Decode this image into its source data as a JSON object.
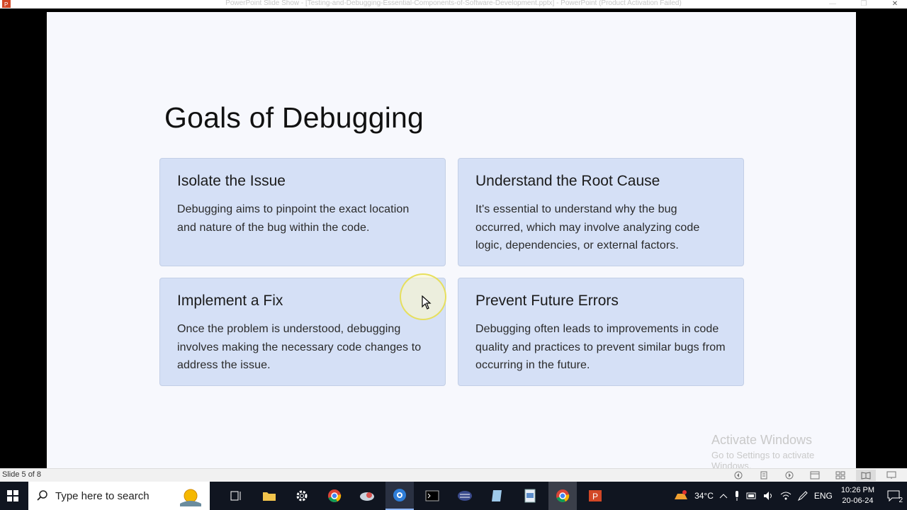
{
  "window": {
    "title": "PowerPoint Slide Show - [Testing-and-Debugging-Essential-Components-of-Software-Development.pptx] - PowerPoint (Product Activation Failed)",
    "minimize": "—",
    "restore": "❐",
    "close": "✕"
  },
  "slide": {
    "title": "Goals of Debugging",
    "cards": [
      {
        "heading": "Isolate the Issue",
        "body": "Debugging aims to pinpoint the exact location and nature of the bug within the code."
      },
      {
        "heading": "Understand the Root Cause",
        "body": "It's essential to understand why the bug occurred, which may involve analyzing code logic, dependencies, or external factors."
      },
      {
        "heading": "Implement a Fix",
        "body": "Once the problem is understood, debugging involves making the necessary code changes to address the issue."
      },
      {
        "heading": "Prevent Future Errors",
        "body": "Debugging often leads to improvements in code quality and practices to prevent similar bugs from occurring in the future."
      }
    ]
  },
  "watermark": {
    "line1": "Activate Windows",
    "line2": "Go to Settings to activate Windows."
  },
  "statusbar": {
    "slide_counter": "Slide 5 of 8",
    "icons": [
      "previous-icon",
      "slide-list-icon",
      "next-icon",
      "normal-view-icon",
      "slide-sorter-icon",
      "reading-view-icon",
      "slideshow-icon"
    ]
  },
  "taskbar": {
    "search_placeholder": "Type here to search",
    "apps": [
      "task-view-icon",
      "file-explorer-icon",
      "settings-icon",
      "chrome-icon",
      "app-icon",
      "browser-icon",
      "terminal-icon",
      "editor-icon",
      "notepad-icon",
      "document-icon",
      "chrome-icon",
      "powerpoint-icon"
    ],
    "temperature": "34°C",
    "language": "ENG",
    "time": "10:26 PM",
    "date": "20-06-24",
    "notification_count": "2"
  },
  "colors": {
    "card_bg": "#d5e0f6",
    "slide_bg": "#f7f8fd",
    "taskbar_bg": "#101520"
  }
}
